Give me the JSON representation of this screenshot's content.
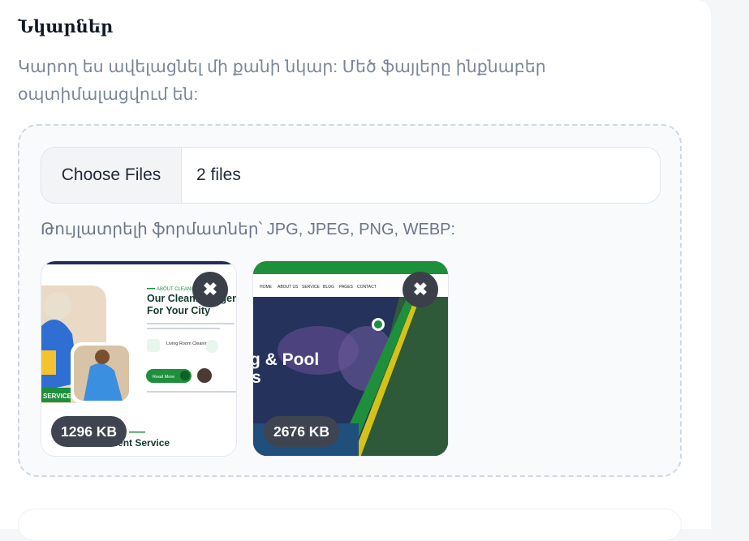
{
  "section": {
    "title": "Նկարներ",
    "description": "Կարող ես ավելացնել մի քանի նկար: Մեծ ֆայլերը ինքնաբեր օպտիմալացվում են:"
  },
  "file_input": {
    "button_label": "Choose Files",
    "status": "2 files"
  },
  "formats_note": "Թույլատրելի ֆորմատներ՝ JPG, JPEG, PNG, WEBP:",
  "previews": [
    {
      "size": "1296 KB",
      "remove_icon": "close-icon",
      "content": {
        "eyebrow": "ABOUT CLEANING",
        "heading_line1": "Our Cleaning Agen",
        "heading_line2": "For Your City",
        "feature1": "Living Room Cleaning",
        "button": "Read More",
        "service_tag": "SERVICE",
        "bottom_heading": "cellent Service"
      }
    },
    {
      "size": "2676 KB",
      "remove_icon": "close-icon",
      "content": {
        "nav": [
          "HOME",
          "ABOUT US",
          "SERVICE",
          "BLOG",
          "PAGES",
          "CONTACT"
        ],
        "heading_line1": "g & Pool",
        "heading_line2": "s"
      }
    }
  ],
  "colors": {
    "brand_green": "#1e8f3a",
    "chip_dark": "#3f4451",
    "hero_navy": "#1f2f5a"
  }
}
